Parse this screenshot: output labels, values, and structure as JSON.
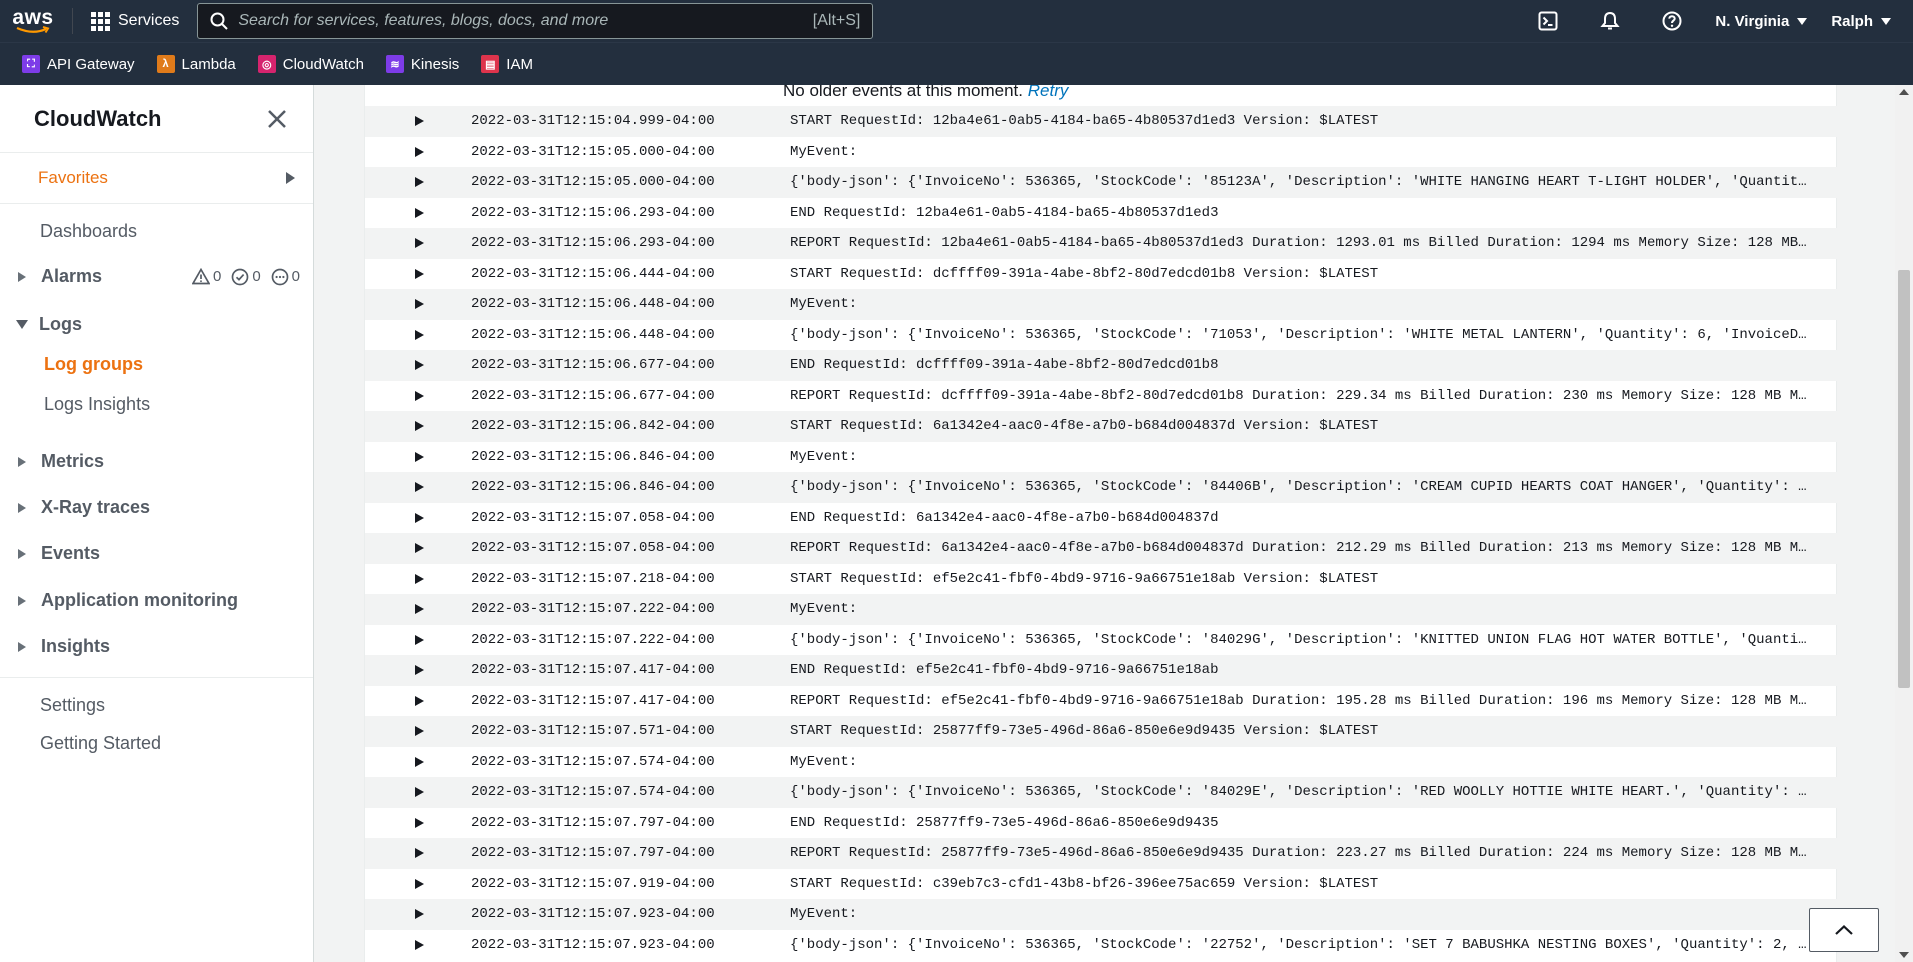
{
  "topnav": {
    "logo_text": "aws",
    "services_label": "Services",
    "search_placeholder": "Search for services, features, blogs, docs, and more",
    "search_shortcut": "[Alt+S]",
    "region": "N. Virginia",
    "user": "Ralph",
    "icons": [
      "cloudshell-icon",
      "bell-icon",
      "help-icon"
    ]
  },
  "favorites_bar": [
    {
      "label": "API Gateway",
      "icon": "api-gateway-icon",
      "color": "#7d3ce8"
    },
    {
      "label": "Lambda",
      "icon": "lambda-icon",
      "color": "#e07b1a"
    },
    {
      "label": "CloudWatch",
      "icon": "cloudwatch-icon",
      "color": "#d6246e"
    },
    {
      "label": "Kinesis",
      "icon": "kinesis-icon",
      "color": "#7d3ce8"
    },
    {
      "label": "IAM",
      "icon": "iam-icon",
      "color": "#dd344c"
    }
  ],
  "sidebar": {
    "title": "CloudWatch",
    "favorites": "Favorites",
    "dashboards": "Dashboards",
    "alarms": {
      "label": "Alarms",
      "in_alarm": "0",
      "ok": "0",
      "insufficient": "0"
    },
    "logs": {
      "label": "Logs",
      "items": [
        "Log groups",
        "Logs Insights"
      ],
      "active": "Log groups"
    },
    "sections": [
      "Metrics",
      "X-Ray traces",
      "Events",
      "Application monitoring",
      "Insights"
    ],
    "settings": "Settings",
    "getting_started": "Getting Started"
  },
  "log_events": {
    "no_older_text": "No older events at this moment.",
    "retry_label": "Retry",
    "rows": [
      {
        "ts": "2022-03-31T12:15:04.999-04:00",
        "msg": "START RequestId: 12ba4e61-0ab5-4184-ba65-4b80537d1ed3 Version: $LATEST"
      },
      {
        "ts": "2022-03-31T12:15:05.000-04:00",
        "msg": "MyEvent:"
      },
      {
        "ts": "2022-03-31T12:15:05.000-04:00",
        "msg": "{'body-json': {'InvoiceNo': 536365, 'StockCode': '85123A', 'Description': 'WHITE HANGING HEART T-LIGHT HOLDER', 'Quantity':…"
      },
      {
        "ts": "2022-03-31T12:15:06.293-04:00",
        "msg": "END RequestId: 12ba4e61-0ab5-4184-ba65-4b80537d1ed3"
      },
      {
        "ts": "2022-03-31T12:15:06.293-04:00",
        "msg": "REPORT RequestId: 12ba4e61-0ab5-4184-ba65-4b80537d1ed3 Duration: 1293.01 ms Billed Duration: 1294 ms Memory Size: 128 MB Ma…"
      },
      {
        "ts": "2022-03-31T12:15:06.444-04:00",
        "msg": "START RequestId: dcffff09-391a-4abe-8bf2-80d7edcd01b8 Version: $LATEST"
      },
      {
        "ts": "2022-03-31T12:15:06.448-04:00",
        "msg": "MyEvent:"
      },
      {
        "ts": "2022-03-31T12:15:06.448-04:00",
        "msg": "{'body-json': {'InvoiceNo': 536365, 'StockCode': '71053', 'Description': 'WHITE METAL LANTERN', 'Quantity': 6, 'InvoiceDate…"
      },
      {
        "ts": "2022-03-31T12:15:06.677-04:00",
        "msg": "END RequestId: dcffff09-391a-4abe-8bf2-80d7edcd01b8"
      },
      {
        "ts": "2022-03-31T12:15:06.677-04:00",
        "msg": "REPORT RequestId: dcffff09-391a-4abe-8bf2-80d7edcd01b8 Duration: 229.34 ms Billed Duration: 230 ms Memory Size: 128 MB Max …"
      },
      {
        "ts": "2022-03-31T12:15:06.842-04:00",
        "msg": "START RequestId: 6a1342e4-aac0-4f8e-a7b0-b684d004837d Version: $LATEST"
      },
      {
        "ts": "2022-03-31T12:15:06.846-04:00",
        "msg": "MyEvent:"
      },
      {
        "ts": "2022-03-31T12:15:06.846-04:00",
        "msg": "{'body-json': {'InvoiceNo': 536365, 'StockCode': '84406B', 'Description': 'CREAM CUPID HEARTS COAT HANGER', 'Quantity': 8, …"
      },
      {
        "ts": "2022-03-31T12:15:07.058-04:00",
        "msg": "END RequestId: 6a1342e4-aac0-4f8e-a7b0-b684d004837d"
      },
      {
        "ts": "2022-03-31T12:15:07.058-04:00",
        "msg": "REPORT RequestId: 6a1342e4-aac0-4f8e-a7b0-b684d004837d Duration: 212.29 ms Billed Duration: 213 ms Memory Size: 128 MB Max …"
      },
      {
        "ts": "2022-03-31T12:15:07.218-04:00",
        "msg": "START RequestId: ef5e2c41-fbf0-4bd9-9716-9a66751e18ab Version: $LATEST"
      },
      {
        "ts": "2022-03-31T12:15:07.222-04:00",
        "msg": "MyEvent:"
      },
      {
        "ts": "2022-03-31T12:15:07.222-04:00",
        "msg": "{'body-json': {'InvoiceNo': 536365, 'StockCode': '84029G', 'Description': 'KNITTED UNION FLAG HOT WATER BOTTLE', 'Quantity'…"
      },
      {
        "ts": "2022-03-31T12:15:07.417-04:00",
        "msg": "END RequestId: ef5e2c41-fbf0-4bd9-9716-9a66751e18ab"
      },
      {
        "ts": "2022-03-31T12:15:07.417-04:00",
        "msg": "REPORT RequestId: ef5e2c41-fbf0-4bd9-9716-9a66751e18ab Duration: 195.28 ms Billed Duration: 196 ms Memory Size: 128 MB Max …"
      },
      {
        "ts": "2022-03-31T12:15:07.571-04:00",
        "msg": "START RequestId: 25877ff9-73e5-496d-86a6-850e6e9d9435 Version: $LATEST"
      },
      {
        "ts": "2022-03-31T12:15:07.574-04:00",
        "msg": "MyEvent:"
      },
      {
        "ts": "2022-03-31T12:15:07.574-04:00",
        "msg": "{'body-json': {'InvoiceNo': 536365, 'StockCode': '84029E', 'Description': 'RED WOOLLY HOTTIE WHITE HEART.', 'Quantity': 6, …"
      },
      {
        "ts": "2022-03-31T12:15:07.797-04:00",
        "msg": "END RequestId: 25877ff9-73e5-496d-86a6-850e6e9d9435"
      },
      {
        "ts": "2022-03-31T12:15:07.797-04:00",
        "msg": "REPORT RequestId: 25877ff9-73e5-496d-86a6-850e6e9d9435 Duration: 223.27 ms Billed Duration: 224 ms Memory Size: 128 MB Max …"
      },
      {
        "ts": "2022-03-31T12:15:07.919-04:00",
        "msg": "START RequestId: c39eb7c3-cfd1-43b8-bf26-396ee75ac659 Version: $LATEST"
      },
      {
        "ts": "2022-03-31T12:15:07.923-04:00",
        "msg": "MyEvent:"
      },
      {
        "ts": "2022-03-31T12:15:07.923-04:00",
        "msg": "{'body-json': {'InvoiceNo': 536365, 'StockCode': '22752', 'Description': 'SET 7 BABUSHKA NESTING BOXES', 'Quantity': 2, 'In…"
      }
    ]
  },
  "colors": {
    "nav_bg": "#232f3e",
    "accent_orange": "#ec7211",
    "link_blue": "#0073bb"
  }
}
